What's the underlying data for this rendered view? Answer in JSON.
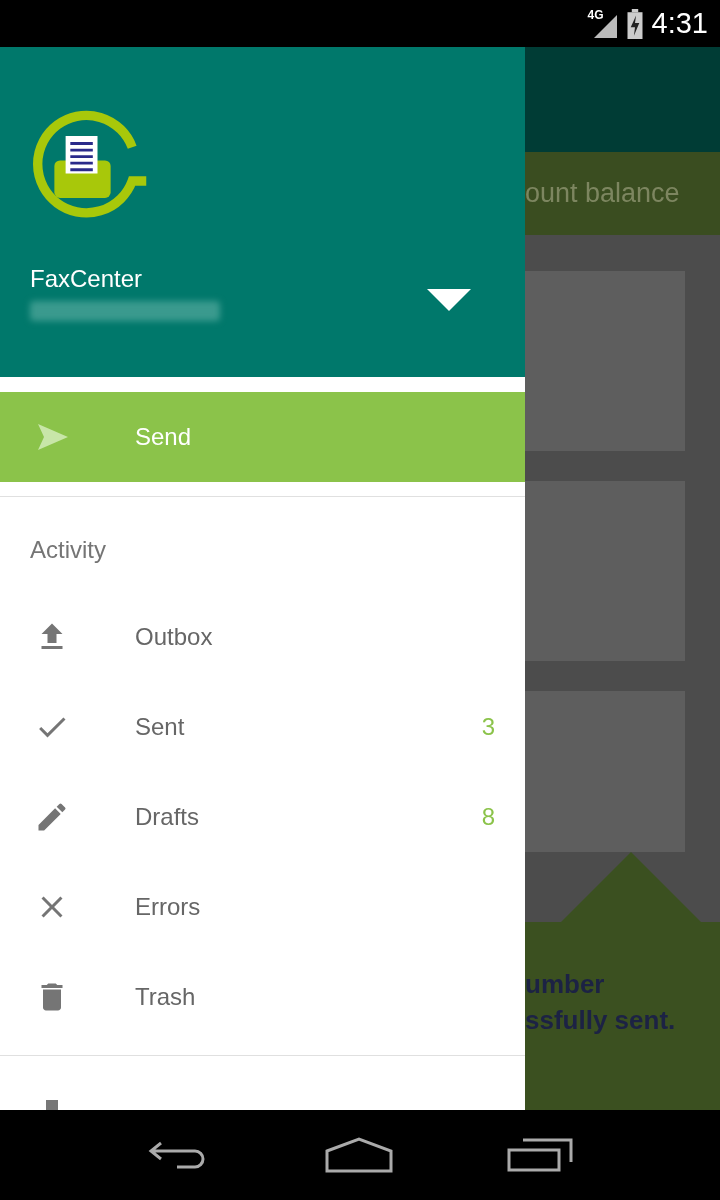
{
  "status_bar": {
    "network": "4G",
    "time": "4:31"
  },
  "drawer": {
    "app_name": "FaxCenter",
    "primary": {
      "label": "Send",
      "selected": true
    },
    "section": "Activity",
    "items": [
      {
        "label": "Outbox"
      },
      {
        "label": "Sent",
        "count": "3"
      },
      {
        "label": "Drafts",
        "count": "8"
      },
      {
        "label": "Errors"
      },
      {
        "label": "Trash"
      }
    ]
  },
  "background": {
    "balance_label": "ount balance",
    "message_lines": [
      "umber",
      "ssfully sent."
    ]
  }
}
